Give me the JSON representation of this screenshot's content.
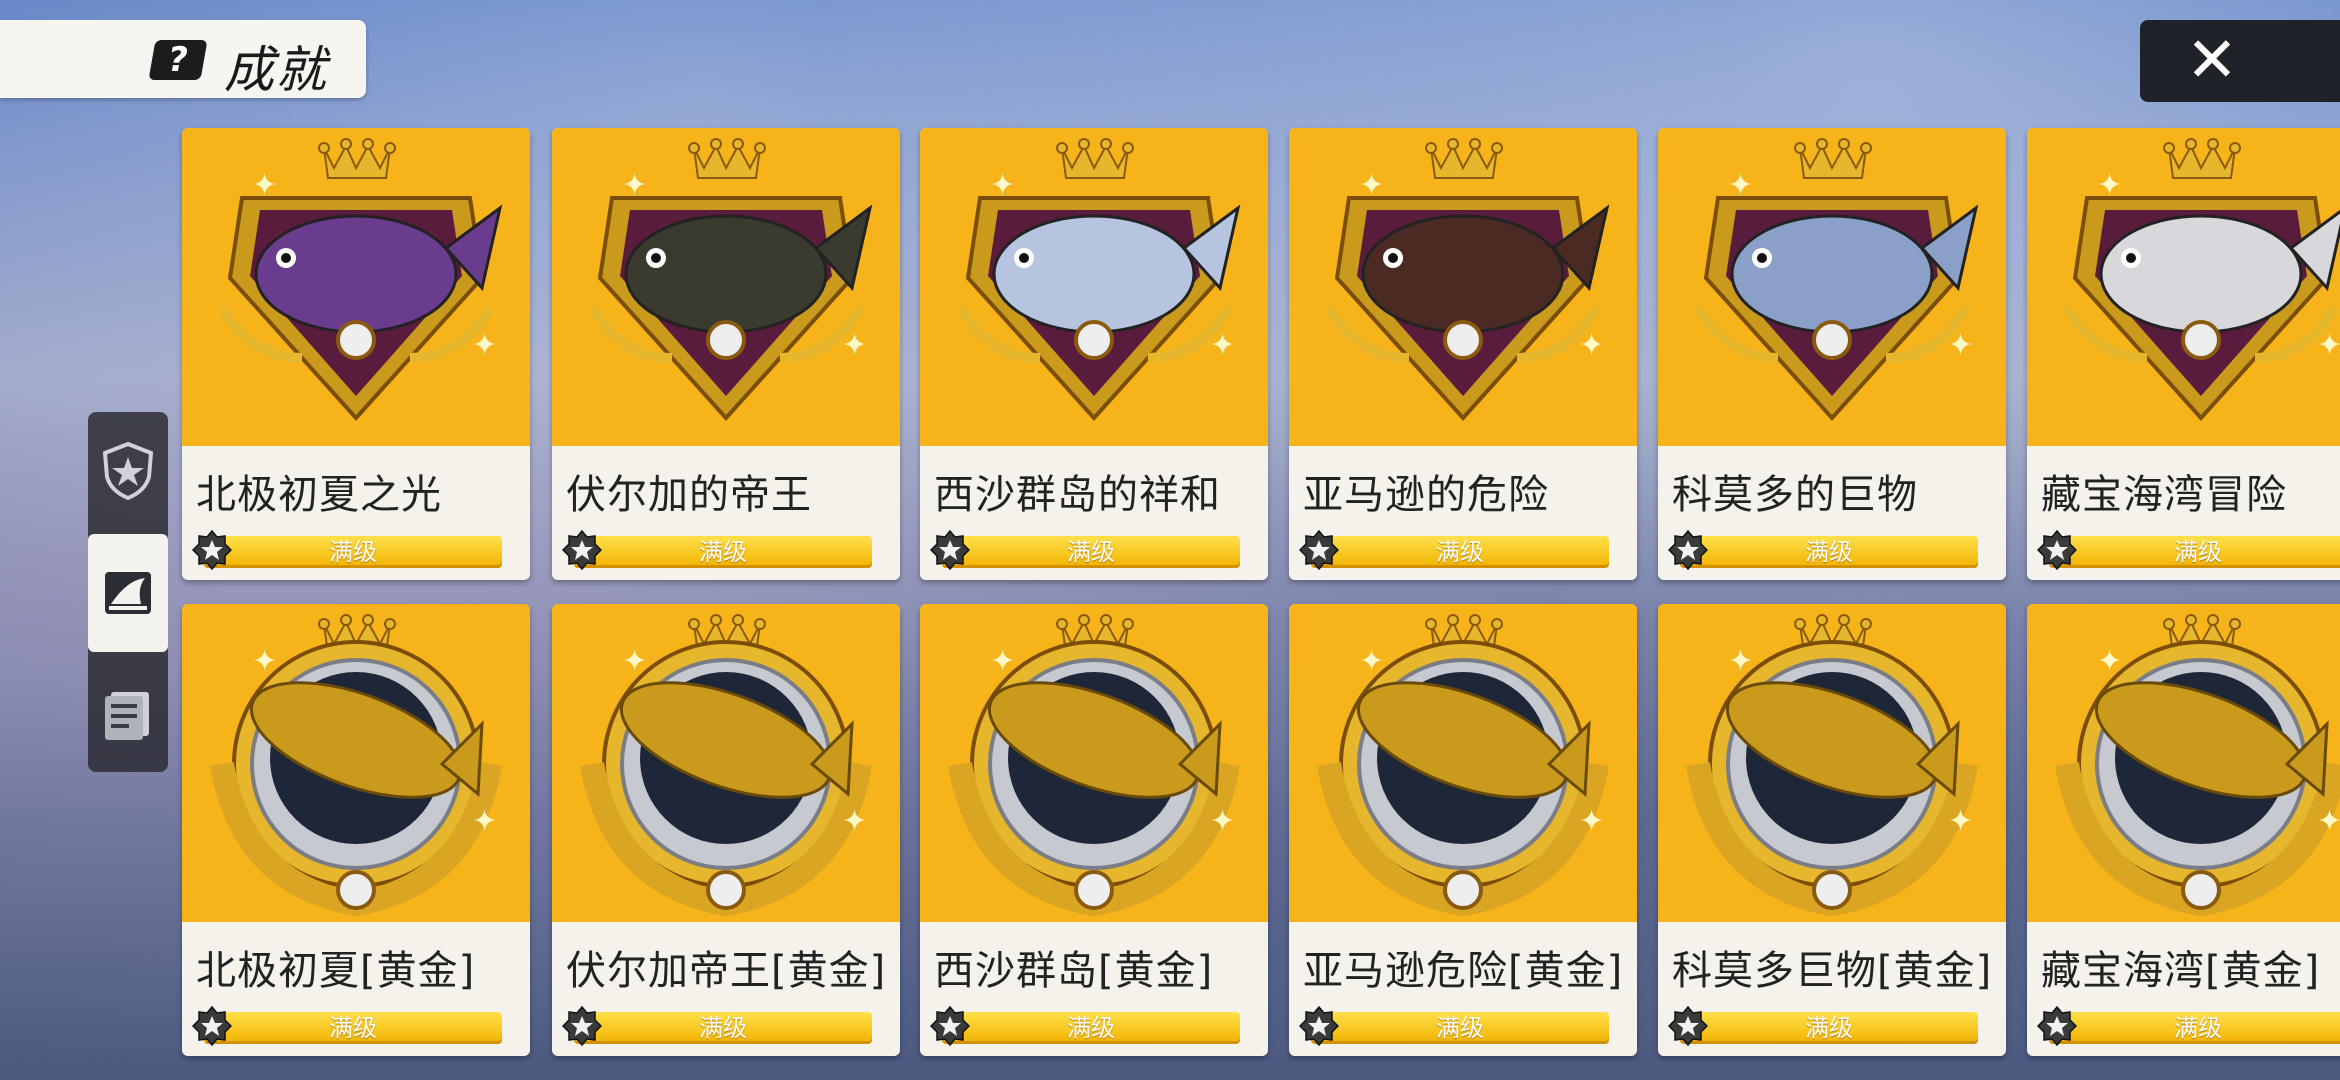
{
  "header": {
    "title": "成就",
    "title_icon": "question-icon",
    "close_label": "✕"
  },
  "side_tabs": [
    {
      "icon": "star-shield-icon",
      "active": false
    },
    {
      "icon": "shark-card-icon",
      "active": true
    },
    {
      "icon": "fish-album-icon",
      "active": false
    }
  ],
  "colors": {
    "card_art": "#f7b31a",
    "bar": "#f7c000",
    "panel": "#f4f2ea"
  },
  "achievements": [
    {
      "name": "北极初夏之光",
      "level": "满级",
      "badge": "diamond",
      "fish_color": "#6a3c8e"
    },
    {
      "name": "伏尔加的帝王",
      "level": "满级",
      "badge": "diamond",
      "fish_color": "#3a3a2e"
    },
    {
      "name": "西沙群岛的祥和",
      "level": "满级",
      "badge": "diamond",
      "fish_color": "#b6c4e0"
    },
    {
      "name": "亚马逊的危险",
      "level": "满级",
      "badge": "diamond",
      "fish_color": "#4a2a22"
    },
    {
      "name": "科莫多的巨物",
      "level": "满级",
      "badge": "diamond",
      "fish_color": "#8aa0c8"
    },
    {
      "name": "藏宝海湾冒险",
      "level": "满级",
      "badge": "diamond",
      "fish_color": "#d8d8dc"
    },
    {
      "name": "北极初夏[黄金]",
      "level": "满级",
      "badge": "laurel",
      "fish_color": "#c99a1c"
    },
    {
      "name": "伏尔加帝王[黄金]",
      "level": "满级",
      "badge": "laurel",
      "fish_color": "#c99a1c"
    },
    {
      "name": "西沙群岛[黄金]",
      "level": "满级",
      "badge": "laurel",
      "fish_color": "#c99a1c"
    },
    {
      "name": "亚马逊危险[黄金]",
      "level": "满级",
      "badge": "laurel",
      "fish_color": "#c99a1c"
    },
    {
      "name": "科莫多巨物[黄金]",
      "level": "满级",
      "badge": "laurel",
      "fish_color": "#c99a1c"
    },
    {
      "name": "藏宝海湾[黄金]",
      "level": "满级",
      "badge": "laurel",
      "fish_color": "#c99a1c"
    }
  ]
}
